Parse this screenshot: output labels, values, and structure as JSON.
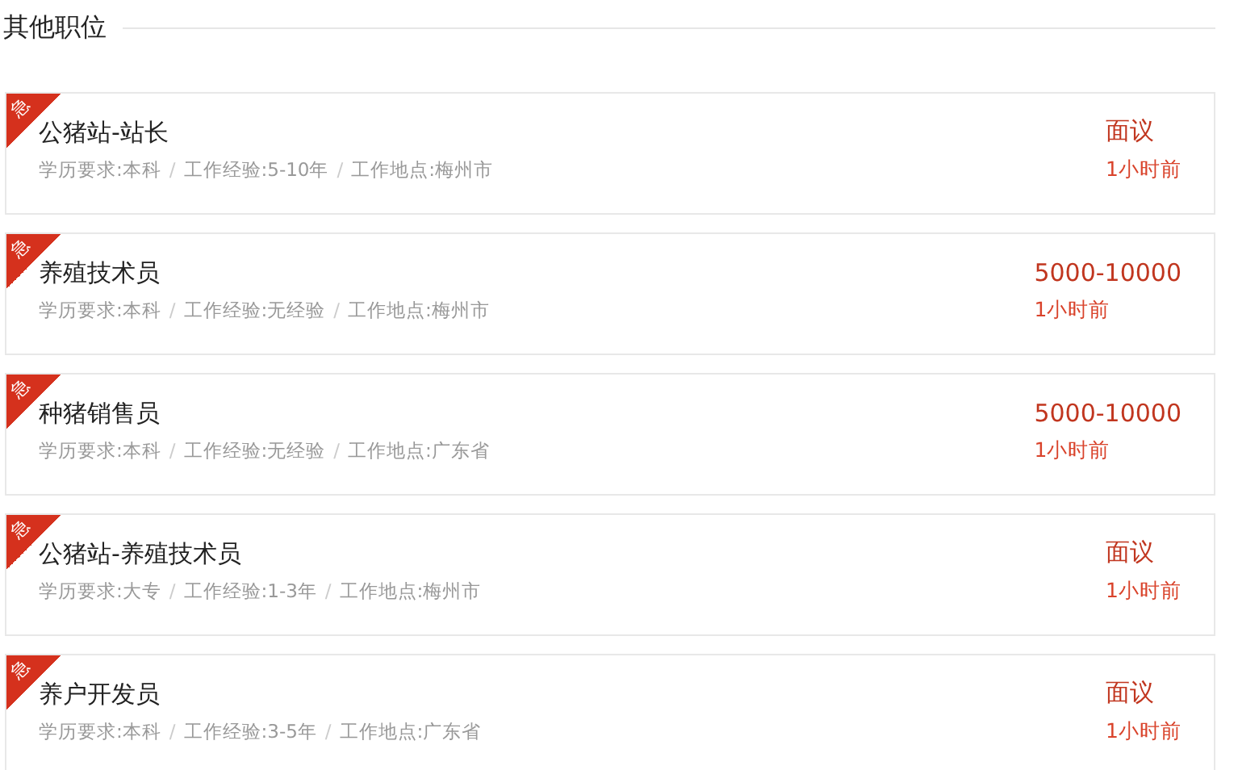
{
  "section_title": "其他职位",
  "separator": "/",
  "jobs": [
    {
      "badge": "急",
      "title": "公猪站-站长",
      "meta": [
        "学历要求:本科",
        "工作经验:5-10年",
        "工作地点:梅州市"
      ],
      "salary": "面议",
      "posted": "1小时前"
    },
    {
      "badge": "急",
      "title": "养殖技术员",
      "meta": [
        "学历要求:本科",
        "工作经验:无经验",
        "工作地点:梅州市"
      ],
      "salary": "5000-10000",
      "posted": "1小时前"
    },
    {
      "badge": "急",
      "title": "种猪销售员",
      "meta": [
        "学历要求:本科",
        "工作经验:无经验",
        "工作地点:广东省"
      ],
      "salary": "5000-10000",
      "posted": "1小时前"
    },
    {
      "badge": "急",
      "title": "公猪站-养殖技术员",
      "meta": [
        "学历要求:大专",
        "工作经验:1-3年",
        "工作地点:梅州市"
      ],
      "salary": "面议",
      "posted": "1小时前"
    },
    {
      "badge": "急",
      "title": "养户开发员",
      "meta": [
        "学历要求:本科",
        "工作经验:3-5年",
        "工作地点:广东省"
      ],
      "salary": "面议",
      "posted": "1小时前"
    }
  ]
}
